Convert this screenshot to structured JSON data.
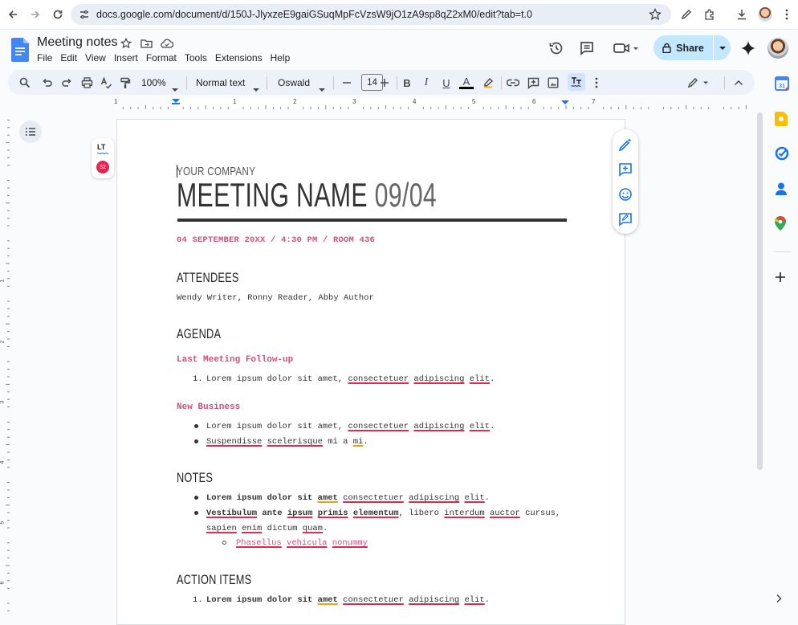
{
  "browser": {
    "url": "docs.google.com/document/d/150J-JlyxzeE9gaiGSuqMpFcVzsW9jO1zA9sp8qZ2xM0/edit?tab=t.0"
  },
  "doc": {
    "title": "Meeting notes",
    "menu": [
      "File",
      "Edit",
      "View",
      "Insert",
      "Format",
      "Tools",
      "Extensions",
      "Help"
    ],
    "share_label": "Share"
  },
  "toolbar": {
    "zoom": "100%",
    "style": "Normal text",
    "font": "Oswald",
    "font_size": "14",
    "bold": "B",
    "italic": "I",
    "underline": "U",
    "text_color": "A"
  },
  "ruler": {
    "labels": [
      "1",
      "1",
      "2",
      "3",
      "4",
      "5",
      "6",
      "7"
    ],
    "vlabels": [
      "1",
      "2",
      "3",
      "4",
      "5",
      "6"
    ]
  },
  "languagetool": {
    "logo": "LT",
    "count": "32"
  },
  "content": {
    "company": "YOUR COMPANY",
    "meeting_name": "MEETING NAME",
    "meeting_date": "09/04",
    "date_line": "04 SEPTEMBER 20XX / 4:30 PM / ROOM 436",
    "attendees_heading": "ATTENDEES",
    "attendees": "Wendy Writer, Ronny Reader, Abby Author",
    "agenda_heading": "AGENDA",
    "last_meeting_heading": "Last Meeting Follow-up",
    "lorem_a": "Lorem ipsum dolor sit amet,",
    "consectetuer": "consectetuer",
    "adipiscing": "adipiscing",
    "elit": "elit",
    "period": ".",
    "new_business_heading": "New Business",
    "suspendisse": "Suspendisse",
    "scelerisque": "scelerisque",
    "mi_a": "mi a",
    "mi": "mi",
    "notes_heading": "NOTES",
    "lorem_bold": "Lorem ipsum dolor sit",
    "amet": "amet",
    "vestibulum": "Vestibulum",
    "ante": "ante",
    "ipsum": "ipsum",
    "primis": "primis",
    "elementum": "elementum",
    "libero": ", libero",
    "interdum": "interdum",
    "auctor": "auctor",
    "cursus": "cursus,",
    "sapien": "sapien",
    "enim": "enim",
    "dictum": "dictum",
    "quam": "quam",
    "phasellus": "Phasellus",
    "vehicula": "vehicula",
    "nonummy": "nonummy",
    "action_heading": "ACTION ITEMS",
    "num1": "1.",
    "num2": "1.",
    "num3": "1."
  },
  "colors": {
    "accent_pink": "#d14f79",
    "share_bg": "#c2e7ff",
    "toolbar_bg": "#edf2fa"
  }
}
